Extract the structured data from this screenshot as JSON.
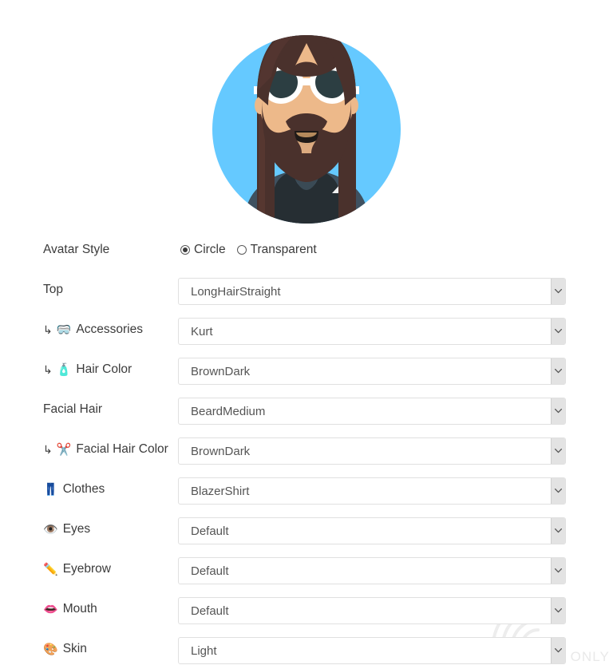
{
  "avatar": {
    "alt": "Generated avatar preview",
    "style": "Circle",
    "colors": {
      "background": "#65c9ff",
      "hair": "#4a312c",
      "hair_highlight": "#5c3a33",
      "skin": "#edb98a",
      "skin_shadow": "#d9a178",
      "beard": "#4a312c",
      "glasses_frame": "#ffffff",
      "glasses_lens": "#2c3e42",
      "shirt": "#262e33",
      "blazer": "#3a4a55",
      "blazer_light": "#4c5f6b",
      "mouth": "#000000"
    }
  },
  "form": {
    "rows": [
      {
        "id": "avatar-style",
        "label": "Avatar Style",
        "icon": "",
        "sub": false,
        "control": "radio",
        "options": [
          "Circle",
          "Transparent"
        ],
        "selected": "Circle"
      },
      {
        "id": "top",
        "label": "Top",
        "icon": "",
        "sub": false,
        "control": "select",
        "value": "LongHairStraight"
      },
      {
        "id": "accessories",
        "label": "Accessories",
        "icon": "🥽",
        "icon_name": "goggles-icon",
        "sub": true,
        "control": "select",
        "value": "Kurt"
      },
      {
        "id": "hair-color",
        "label": "Hair Color",
        "icon": "🧴",
        "icon_name": "lotion-bottle-icon",
        "sub": true,
        "control": "select",
        "value": "BrownDark"
      },
      {
        "id": "facial-hair",
        "label": "Facial Hair",
        "icon": "",
        "sub": false,
        "control": "select",
        "value": "BeardMedium"
      },
      {
        "id": "facial-hair-color",
        "label": "Facial Hair Color",
        "icon": "✂️",
        "icon_name": "scissors-icon",
        "sub": true,
        "control": "select",
        "value": "BrownDark"
      },
      {
        "id": "clothes",
        "label": "Clothes",
        "icon": "👖",
        "icon_name": "jeans-icon",
        "sub": false,
        "control": "select",
        "value": "BlazerShirt"
      },
      {
        "id": "eyes",
        "label": "Eyes",
        "icon": "👁️",
        "icon_name": "eye-icon",
        "sub": false,
        "control": "select",
        "value": "Default"
      },
      {
        "id": "eyebrow",
        "label": "Eyebrow",
        "icon": "✏️",
        "icon_name": "pencil-icon",
        "sub": false,
        "control": "select",
        "value": "Default"
      },
      {
        "id": "mouth",
        "label": "Mouth",
        "icon": "👄",
        "icon_name": "lips-icon",
        "sub": false,
        "control": "select",
        "value": "Default"
      },
      {
        "id": "skin",
        "label": "Skin",
        "icon": "🎨",
        "icon_name": "palette-icon",
        "sub": false,
        "control": "select",
        "value": "Light"
      }
    ],
    "sub_arrow_glyph": "↳",
    "dropdown_arrow": "chevron-down-icon"
  },
  "watermark": {
    "text": "PROGRAMMING NOT ONLY",
    "color": "#ececec"
  }
}
